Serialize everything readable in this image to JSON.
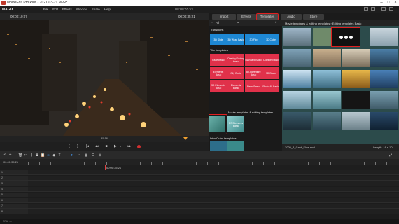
{
  "window": {
    "title": "MovieEdit Pro Plus - 2021-03-21.MVP*"
  },
  "menubar": {
    "logo": "MAGIX",
    "items": [
      "File",
      "Edit",
      "Effects",
      "Window",
      "Share",
      "Help"
    ],
    "timecode": "00:00:35:21"
  },
  "preview": {
    "timecode_left": "00:00:10:07",
    "timecode_right": "00:00:35:21",
    "scrub_label": "35:16"
  },
  "media_pool": {
    "tabs": [
      "Import",
      "Effects",
      "Templates",
      "Audio",
      "Store"
    ],
    "active_tab": "Templates",
    "category_select": "All",
    "sections": {
      "transitions": "Transitions",
      "title_templates": "Title templates",
      "movie_templates": "Movie templates & editing templates",
      "intro_outro": "Intro/Outro templates"
    },
    "transition_tiles": [
      "3D Slide",
      "3D Wrap Basic",
      "3D Flip",
      "3D Cube"
    ],
    "title_tiles": [
      "Fade Basic",
      "Overlay/Ending basic",
      "Standard Basic",
      "Comfort Basic",
      "Elements Basic",
      "City Basic",
      "3D Adventure Basic",
      "3D Basic",
      "3D Elements Basic",
      "Elements Basic",
      "Neon Basic",
      "Photo 4k Basic"
    ],
    "movie_template_tile": "ES Elements Basic",
    "right_header": "Movie templates & editing templates › Editing templates Basic",
    "right_footer_left": "2020_4_Card_Flow.mvtl",
    "right_footer_right": "Length: 16 s 10"
  },
  "timeline": {
    "ruler_timecode": "00:00:35:21",
    "header_timecode": "00:00:35:21",
    "track_labels": [
      "1",
      "2",
      "3",
      "4",
      "5",
      "6",
      "7",
      "8"
    ]
  },
  "status": {
    "text": "CPU: —"
  }
}
